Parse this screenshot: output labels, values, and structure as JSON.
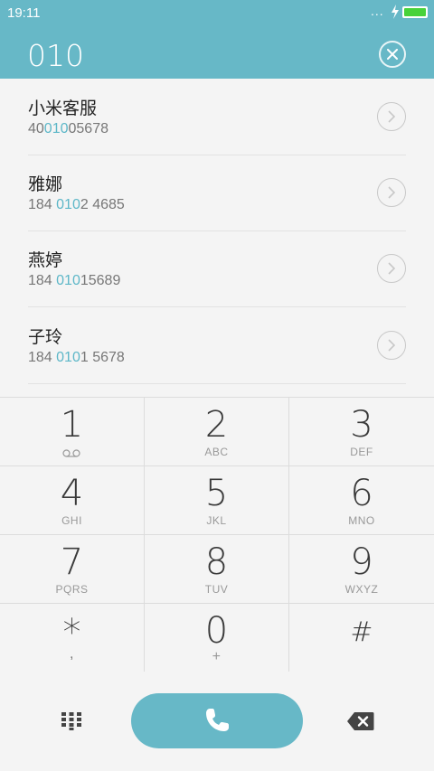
{
  "status": {
    "time": "19:11",
    "dots": "..."
  },
  "header": {
    "dialed": "010"
  },
  "results": [
    {
      "name": "小米客服",
      "number_pre": "40",
      "number_hl": "010",
      "number_post": "05678"
    },
    {
      "name": "雅娜",
      "number_pre": "184 ",
      "number_hl": "010",
      "number_post": "2 4685"
    },
    {
      "name": "燕婷",
      "number_pre": "184 ",
      "number_hl": "010",
      "number_post": "15689"
    },
    {
      "name": "子玲",
      "number_pre": "184 ",
      "number_hl": "010",
      "number_post": "1 5678"
    }
  ],
  "keypad": [
    {
      "digit": "1",
      "letters": ""
    },
    {
      "digit": "2",
      "letters": "ABC"
    },
    {
      "digit": "3",
      "letters": "DEF"
    },
    {
      "digit": "4",
      "letters": "GHI"
    },
    {
      "digit": "5",
      "letters": "JKL"
    },
    {
      "digit": "6",
      "letters": "MNO"
    },
    {
      "digit": "7",
      "letters": "PQRS"
    },
    {
      "digit": "8",
      "letters": "TUV"
    },
    {
      "digit": "9",
      "letters": "WXYZ"
    },
    {
      "digit": "*",
      "letters": ","
    },
    {
      "digit": "0",
      "letters": "+"
    },
    {
      "digit": "#",
      "letters": ""
    }
  ],
  "colors": {
    "accent": "#67b8c7",
    "highlight": "#5db7c8",
    "battery": "#48d23a"
  },
  "icons": {
    "clear": "close-icon",
    "arrow": "chevron-right-icon",
    "voicemail": "voicemail-icon",
    "dialpad": "dialpad-icon",
    "call": "phone-icon",
    "backspace": "backspace-icon"
  }
}
